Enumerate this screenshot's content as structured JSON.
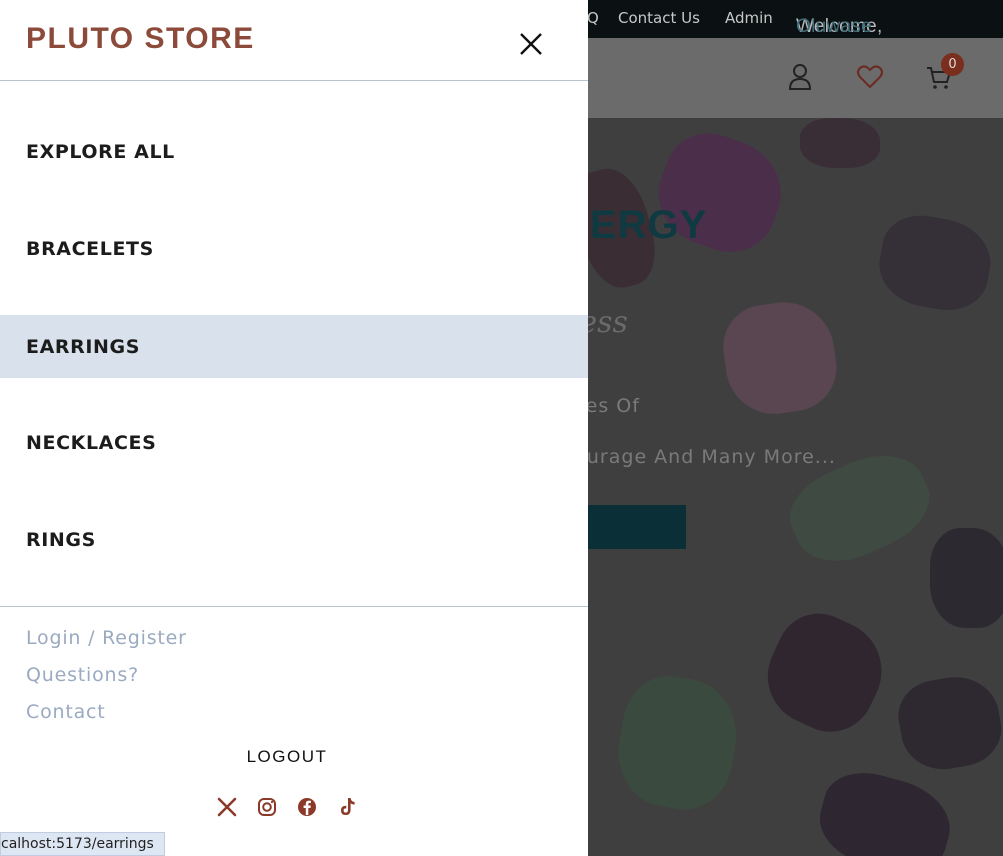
{
  "background": {
    "topbar": {
      "faq_fragment": "Q",
      "contact": "Contact Us",
      "admin": "Admin",
      "welcome": "Welcome,",
      "user_name": "Oluwase"
    },
    "header": {
      "cart_count": "0",
      "icons": [
        "user-icon",
        "heart-icon",
        "cart-icon"
      ]
    },
    "hero": {
      "title_fragment": "NERGY",
      "script_fragment": "ness",
      "line1_fragment": "ones Of",
      "line2_fragment": "Courage And Many More..."
    }
  },
  "drawer": {
    "brand": "PLUTO STORE",
    "close_icon": "close-icon",
    "nav_items": [
      {
        "label": "EXPLORE ALL",
        "active": false
      },
      {
        "label": "BRACELETS",
        "active": false
      },
      {
        "label": "EARRINGS",
        "active": true
      },
      {
        "label": "NECKLACES",
        "active": false
      },
      {
        "label": "RINGS",
        "active": false
      }
    ],
    "secondary_links": [
      "Login / Register",
      "Questions?",
      "Contact"
    ],
    "logout": "LOGOUT",
    "social_icons": [
      "x-icon",
      "instagram-icon",
      "facebook-icon",
      "tiktok-icon"
    ],
    "accent_color": "#8b4a3a"
  },
  "status_bar": {
    "url": "calhost:5173/earrings"
  }
}
